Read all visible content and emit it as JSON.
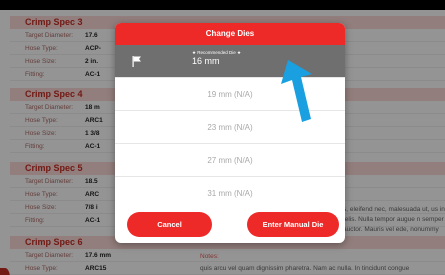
{
  "specs": [
    {
      "title": "Crimp Spec 3",
      "rows": [
        {
          "label": "Target Diameter:",
          "value": "17.6"
        },
        {
          "label": "Hose Type:",
          "value": "ACP-"
        },
        {
          "label": "Hose Size:",
          "value": "2 in."
        },
        {
          "label": "Fitting:",
          "value": "AC-1"
        }
      ]
    },
    {
      "title": "Crimp Spec 4",
      "rows": [
        {
          "label": "Target Diameter:",
          "value": "18 m"
        },
        {
          "label": "Hose Type:",
          "value": "ARC1"
        },
        {
          "label": "Hose Size:",
          "value": "1 3/8"
        },
        {
          "label": "Fitting:",
          "value": "AC-1"
        }
      ]
    },
    {
      "title": "Crimp Spec 5",
      "rows": [
        {
          "label": "Target Diameter:",
          "value": "18.5"
        },
        {
          "label": "Hose Type:",
          "value": "ARC"
        },
        {
          "label": "Hose Size:",
          "value": "7/8 i"
        },
        {
          "label": "Fitting:",
          "value": "AC-1"
        }
      ],
      "notes_text": "s, eleifend nec, malesuada ut, us in felis. Nulla tempor augue n semper auctor. Mauris vel ede, nonummy ut, mole"
    },
    {
      "title": "Crimp Spec 6",
      "rows": [
        {
          "label": "Target Diameter:",
          "value": "17.6 mm"
        },
        {
          "label": "Hose Type:",
          "value": "ARC15"
        }
      ],
      "notes_label": "Notes:",
      "notes_text": "quis arcu vel quam dignissim pharetra. Nam ac nulla. In tincidunt congue"
    }
  ],
  "dialog": {
    "title": "Change Dies",
    "recommended_label": "★ Recommended Die ★",
    "recommended_value": "16 mm",
    "options": [
      "19 mm (N/A)",
      "23 mm (N/A)",
      "27 mm (N/A)",
      "31 mm (N/A)"
    ],
    "cancel_label": "Cancel",
    "manual_label": "Enter Manual Die"
  },
  "colors": {
    "accent": "#ee2a28",
    "spec_title_bg": "#fbd9d6",
    "spec_title_text": "#c62d25",
    "arrow": "#1aa0e0"
  },
  "icons": {
    "selected_option": "flag-icon",
    "annotation": "arrow-icon"
  }
}
